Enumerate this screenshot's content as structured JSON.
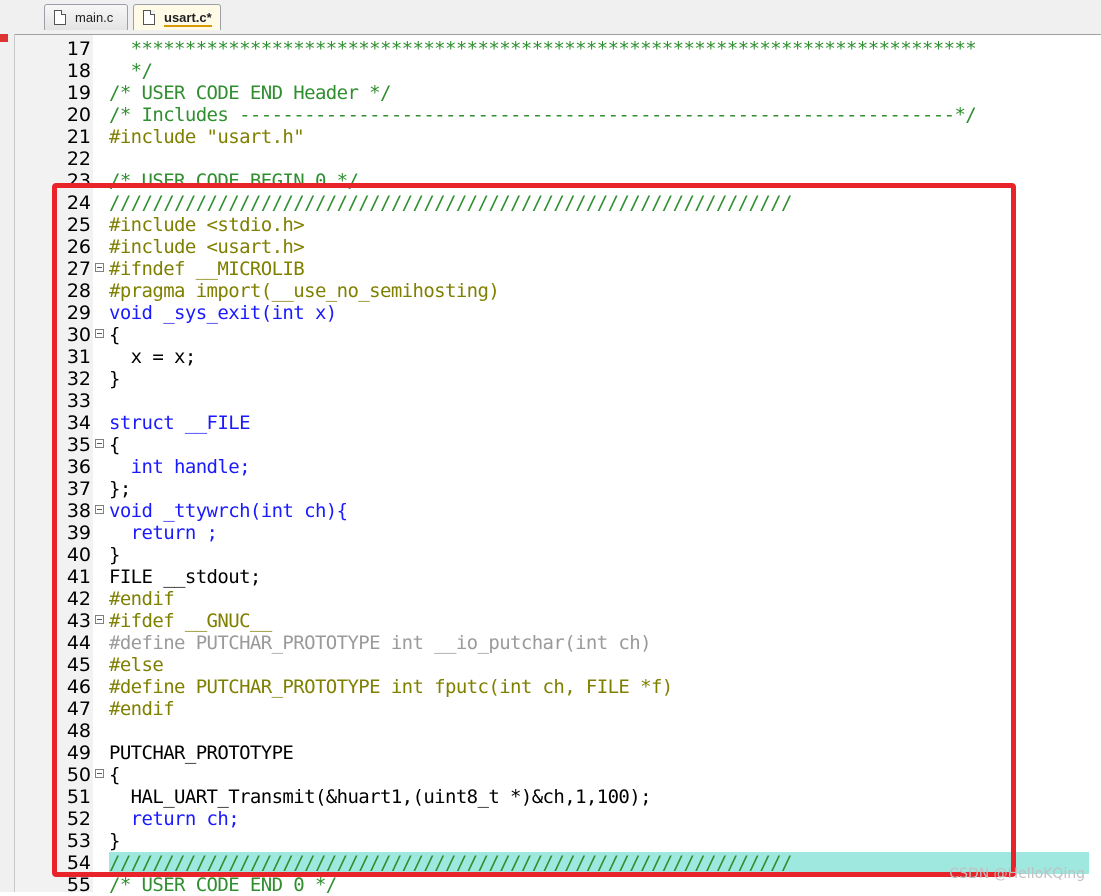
{
  "tabs": [
    {
      "label": "main.c",
      "active": false
    },
    {
      "label": "usart.c*",
      "active": true
    }
  ],
  "lines": [
    {
      "n": "17",
      "c": "  ******************************************************************************",
      "cls": "cmt",
      "fold": false
    },
    {
      "n": "18",
      "c": "  */",
      "cls": "cmt",
      "fold": false
    },
    {
      "n": "19",
      "c": "/* USER CODE END Header */",
      "cls": "cmt",
      "fold": false
    },
    {
      "n": "20",
      "c": "/* Includes ------------------------------------------------------------------*/",
      "cls": "cmt",
      "fold": false
    },
    {
      "n": "21",
      "c": "#include \"usart.h\"",
      "cls": "pp",
      "fold": false
    },
    {
      "n": "22",
      "c": "",
      "cls": "",
      "fold": false
    },
    {
      "n": "23",
      "c": "/* USER CODE BEGIN 0 */",
      "cls": "cmt",
      "fold": false
    },
    {
      "n": "24",
      "c": "///////////////////////////////////////////////////////////////",
      "cls": "cmt",
      "fold": false
    },
    {
      "n": "25",
      "c": "#include <stdio.h>",
      "cls": "pp",
      "fold": false
    },
    {
      "n": "26",
      "c": "#include <usart.h>",
      "cls": "pp",
      "fold": false
    },
    {
      "n": "27",
      "c": "#ifndef __MICROLIB",
      "cls": "pp",
      "fold": true
    },
    {
      "n": "28",
      "c": "#pragma import(__use_no_semihosting)",
      "cls": "pp",
      "fold": false
    },
    {
      "n": "29",
      "c": "void _sys_exit(int x)",
      "cls": "kw",
      "fold": false
    },
    {
      "n": "30",
      "c": "{",
      "cls": "",
      "fold": true
    },
    {
      "n": "31",
      "c": "  x = x;",
      "cls": "",
      "fold": false
    },
    {
      "n": "32",
      "c": "}",
      "cls": "",
      "fold": false
    },
    {
      "n": "33",
      "c": "",
      "cls": "",
      "fold": false
    },
    {
      "n": "34",
      "c": "struct __FILE",
      "cls": "kw",
      "fold": false
    },
    {
      "n": "35",
      "c": "{",
      "cls": "",
      "fold": true
    },
    {
      "n": "36",
      "c": "  int handle;",
      "cls": "kw",
      "fold": false
    },
    {
      "n": "37",
      "c": "};",
      "cls": "",
      "fold": false
    },
    {
      "n": "38",
      "c": "void _ttywrch(int ch){",
      "cls": "kw",
      "fold": true
    },
    {
      "n": "39",
      "c": "  return ;",
      "cls": "kw",
      "fold": false
    },
    {
      "n": "40",
      "c": "}",
      "cls": "",
      "fold": false
    },
    {
      "n": "41",
      "c": "FILE __stdout;",
      "cls": "",
      "fold": false
    },
    {
      "n": "42",
      "c": "#endif",
      "cls": "pp",
      "fold": false
    },
    {
      "n": "43",
      "c": "#ifdef __GNUC__",
      "cls": "pp",
      "fold": true
    },
    {
      "n": "44",
      "c": "#define PUTCHAR_PROTOTYPE int __io_putchar(int ch)",
      "cls": "dim",
      "fold": false
    },
    {
      "n": "45",
      "c": "#else",
      "cls": "pp",
      "fold": false
    },
    {
      "n": "46",
      "c": "#define PUTCHAR_PROTOTYPE int fputc(int ch, FILE *f)",
      "cls": "pp",
      "fold": false
    },
    {
      "n": "47",
      "c": "#endif",
      "cls": "pp",
      "fold": false
    },
    {
      "n": "48",
      "c": "",
      "cls": "",
      "fold": false
    },
    {
      "n": "49",
      "c": "PUTCHAR_PROTOTYPE",
      "cls": "",
      "fold": false
    },
    {
      "n": "50",
      "c": "{",
      "cls": "",
      "fold": true
    },
    {
      "n": "51",
      "c": "  HAL_UART_Transmit(&huart1,(uint8_t *)&ch,1,100);",
      "cls": "",
      "fold": false
    },
    {
      "n": "52",
      "c": "  return ch;",
      "cls": "kw",
      "fold": false
    },
    {
      "n": "53",
      "c": "}",
      "cls": "",
      "fold": false
    },
    {
      "n": "54",
      "c": "///////////////////////////////////////////////////////////////",
      "cls": "cmt",
      "fold": false,
      "highlight": true
    },
    {
      "n": "55",
      "c": "/* USER CODE END 0 */",
      "cls": "cmt",
      "fold": false
    }
  ],
  "watermark": "CSDN @HelloKQing"
}
